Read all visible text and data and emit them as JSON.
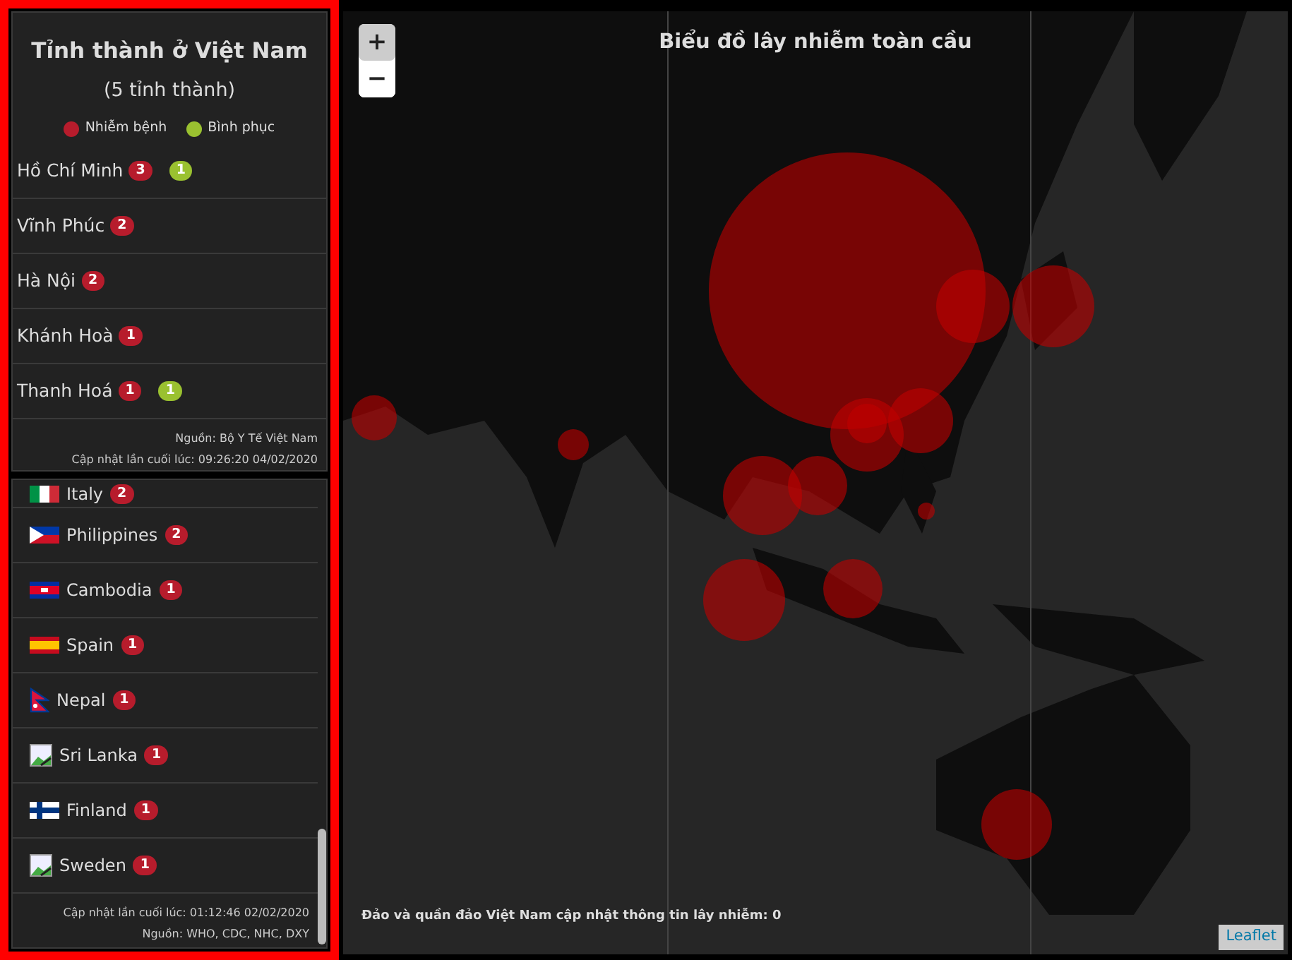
{
  "vietnam_panel": {
    "title": "Tỉnh thành ở Việt Nam",
    "count_note": "(5 tỉnh thành)",
    "legend": [
      {
        "label": "Nhiễm bệnh",
        "color": "#b71c2c"
      },
      {
        "label": "Bình phục",
        "color": "#9ac130"
      }
    ],
    "provinces": [
      {
        "name": "Hồ Chí Minh",
        "infected": "3",
        "recovered": "1"
      },
      {
        "name": "Vĩnh Phúc",
        "infected": "2"
      },
      {
        "name": "Hà Nội",
        "infected": "2"
      },
      {
        "name": "Khánh Hoà",
        "infected": "1"
      },
      {
        "name": "Thanh Hoá",
        "infected": "1",
        "recovered": "1"
      }
    ],
    "source": "Nguồn: Bộ Y Tế Việt Nam",
    "updated": "Cập nhật lần cuối lúc: 09:26:20 04/02/2020"
  },
  "world_panel": {
    "countries": [
      {
        "name": "Italy",
        "infected": "2",
        "kind": "it"
      },
      {
        "name": "Philippines",
        "infected": "2",
        "kind": "ph"
      },
      {
        "name": "Cambodia",
        "infected": "1",
        "kind": "kh"
      },
      {
        "name": "Spain",
        "infected": "1",
        "kind": "es"
      },
      {
        "name": "Nepal",
        "infected": "1",
        "kind": "np"
      },
      {
        "name": "Sri Lanka",
        "infected": "1",
        "kind": "broken"
      },
      {
        "name": "Finland",
        "infected": "1",
        "kind": "fi"
      },
      {
        "name": "Sweden",
        "infected": "1",
        "kind": "broken"
      }
    ],
    "updated": "Cập nhật lần cuối lúc: 01:12:46 02/02/2020",
    "source": "Nguồn: WHO, CDC, NHC, DXY"
  },
  "map": {
    "title": "Biểu đồ lây nhiễm toàn cầu",
    "zoom_in": "+",
    "zoom_out": "−",
    "caption": "Đảo và quần đảo Việt Nam cập nhật thông tin lây nhiễm: 0",
    "attribution": "Leaflet"
  }
}
